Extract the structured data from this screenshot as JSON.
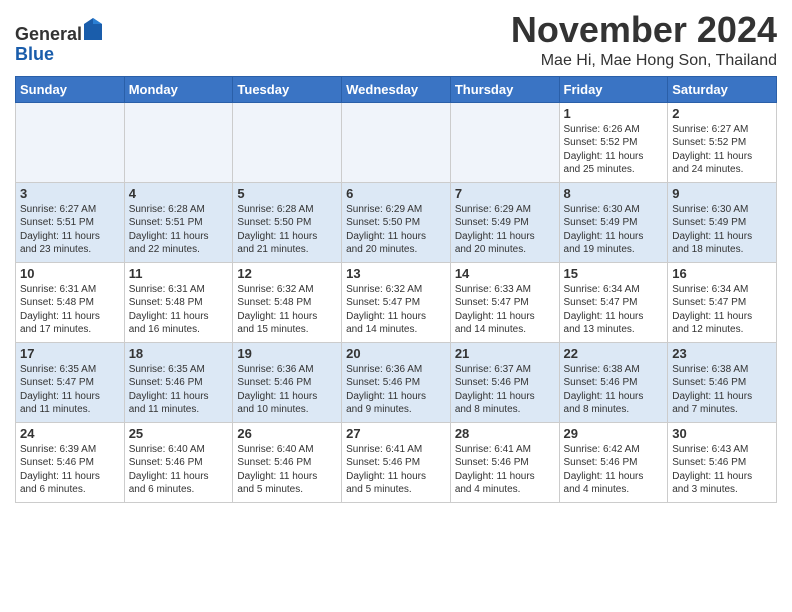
{
  "header": {
    "logo_general": "General",
    "logo_blue": "Blue",
    "month_title": "November 2024",
    "location": "Mae Hi, Mae Hong Son, Thailand"
  },
  "days_of_week": [
    "Sunday",
    "Monday",
    "Tuesday",
    "Wednesday",
    "Thursday",
    "Friday",
    "Saturday"
  ],
  "weeks": [
    [
      {
        "day": "",
        "info": ""
      },
      {
        "day": "",
        "info": ""
      },
      {
        "day": "",
        "info": ""
      },
      {
        "day": "",
        "info": ""
      },
      {
        "day": "",
        "info": ""
      },
      {
        "day": "1",
        "info": "Sunrise: 6:26 AM\nSunset: 5:52 PM\nDaylight: 11 hours\nand 25 minutes."
      },
      {
        "day": "2",
        "info": "Sunrise: 6:27 AM\nSunset: 5:52 PM\nDaylight: 11 hours\nand 24 minutes."
      }
    ],
    [
      {
        "day": "3",
        "info": "Sunrise: 6:27 AM\nSunset: 5:51 PM\nDaylight: 11 hours\nand 23 minutes."
      },
      {
        "day": "4",
        "info": "Sunrise: 6:28 AM\nSunset: 5:51 PM\nDaylight: 11 hours\nand 22 minutes."
      },
      {
        "day": "5",
        "info": "Sunrise: 6:28 AM\nSunset: 5:50 PM\nDaylight: 11 hours\nand 21 minutes."
      },
      {
        "day": "6",
        "info": "Sunrise: 6:29 AM\nSunset: 5:50 PM\nDaylight: 11 hours\nand 20 minutes."
      },
      {
        "day": "7",
        "info": "Sunrise: 6:29 AM\nSunset: 5:49 PM\nDaylight: 11 hours\nand 20 minutes."
      },
      {
        "day": "8",
        "info": "Sunrise: 6:30 AM\nSunset: 5:49 PM\nDaylight: 11 hours\nand 19 minutes."
      },
      {
        "day": "9",
        "info": "Sunrise: 6:30 AM\nSunset: 5:49 PM\nDaylight: 11 hours\nand 18 minutes."
      }
    ],
    [
      {
        "day": "10",
        "info": "Sunrise: 6:31 AM\nSunset: 5:48 PM\nDaylight: 11 hours\nand 17 minutes."
      },
      {
        "day": "11",
        "info": "Sunrise: 6:31 AM\nSunset: 5:48 PM\nDaylight: 11 hours\nand 16 minutes."
      },
      {
        "day": "12",
        "info": "Sunrise: 6:32 AM\nSunset: 5:48 PM\nDaylight: 11 hours\nand 15 minutes."
      },
      {
        "day": "13",
        "info": "Sunrise: 6:32 AM\nSunset: 5:47 PM\nDaylight: 11 hours\nand 14 minutes."
      },
      {
        "day": "14",
        "info": "Sunrise: 6:33 AM\nSunset: 5:47 PM\nDaylight: 11 hours\nand 14 minutes."
      },
      {
        "day": "15",
        "info": "Sunrise: 6:34 AM\nSunset: 5:47 PM\nDaylight: 11 hours\nand 13 minutes."
      },
      {
        "day": "16",
        "info": "Sunrise: 6:34 AM\nSunset: 5:47 PM\nDaylight: 11 hours\nand 12 minutes."
      }
    ],
    [
      {
        "day": "17",
        "info": "Sunrise: 6:35 AM\nSunset: 5:47 PM\nDaylight: 11 hours\nand 11 minutes."
      },
      {
        "day": "18",
        "info": "Sunrise: 6:35 AM\nSunset: 5:46 PM\nDaylight: 11 hours\nand 11 minutes."
      },
      {
        "day": "19",
        "info": "Sunrise: 6:36 AM\nSunset: 5:46 PM\nDaylight: 11 hours\nand 10 minutes."
      },
      {
        "day": "20",
        "info": "Sunrise: 6:36 AM\nSunset: 5:46 PM\nDaylight: 11 hours\nand 9 minutes."
      },
      {
        "day": "21",
        "info": "Sunrise: 6:37 AM\nSunset: 5:46 PM\nDaylight: 11 hours\nand 8 minutes."
      },
      {
        "day": "22",
        "info": "Sunrise: 6:38 AM\nSunset: 5:46 PM\nDaylight: 11 hours\nand 8 minutes."
      },
      {
        "day": "23",
        "info": "Sunrise: 6:38 AM\nSunset: 5:46 PM\nDaylight: 11 hours\nand 7 minutes."
      }
    ],
    [
      {
        "day": "24",
        "info": "Sunrise: 6:39 AM\nSunset: 5:46 PM\nDaylight: 11 hours\nand 6 minutes."
      },
      {
        "day": "25",
        "info": "Sunrise: 6:40 AM\nSunset: 5:46 PM\nDaylight: 11 hours\nand 6 minutes."
      },
      {
        "day": "26",
        "info": "Sunrise: 6:40 AM\nSunset: 5:46 PM\nDaylight: 11 hours\nand 5 minutes."
      },
      {
        "day": "27",
        "info": "Sunrise: 6:41 AM\nSunset: 5:46 PM\nDaylight: 11 hours\nand 5 minutes."
      },
      {
        "day": "28",
        "info": "Sunrise: 6:41 AM\nSunset: 5:46 PM\nDaylight: 11 hours\nand 4 minutes."
      },
      {
        "day": "29",
        "info": "Sunrise: 6:42 AM\nSunset: 5:46 PM\nDaylight: 11 hours\nand 4 minutes."
      },
      {
        "day": "30",
        "info": "Sunrise: 6:43 AM\nSunset: 5:46 PM\nDaylight: 11 hours\nand 3 minutes."
      }
    ]
  ]
}
